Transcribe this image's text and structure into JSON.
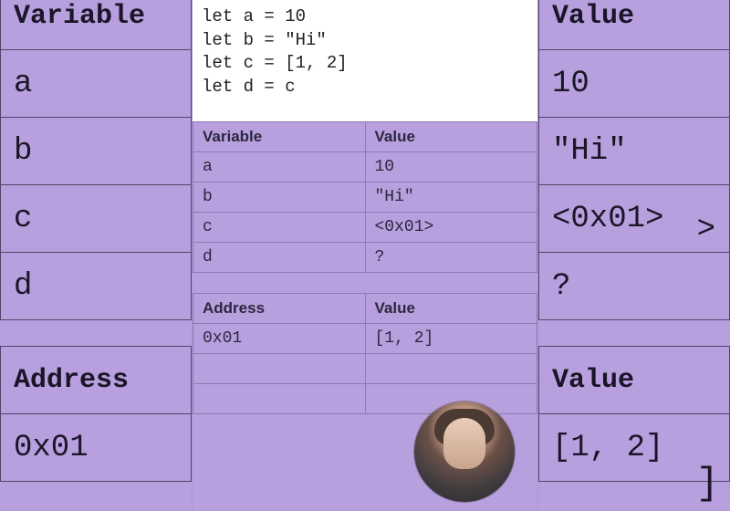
{
  "code": {
    "lines": [
      "let a = 10",
      "let b = \"Hi\"",
      "let c = [1, 2]",
      "let d = c"
    ]
  },
  "var_table": {
    "headers": {
      "col1": "Variable",
      "col2": "Value"
    },
    "rows": [
      {
        "name": "a",
        "value": "10"
      },
      {
        "name": "b",
        "value": "\"Hi\""
      },
      {
        "name": "c",
        "value": "<0x01>"
      },
      {
        "name": "d",
        "value": "?"
      }
    ]
  },
  "addr_table": {
    "headers": {
      "col1": "Address",
      "col2": "Value"
    },
    "rows": [
      {
        "addr": "0x01",
        "value": "[1, 2]"
      }
    ]
  },
  "bg_left": {
    "header": "Variable",
    "rows": [
      "a",
      "b",
      "c",
      "d"
    ],
    "header2": "Address",
    "rows2": [
      "0x01"
    ]
  },
  "bg_right": {
    "header": "Value",
    "rows": [
      "10",
      "\"Hi\"",
      "<0x01>",
      "?"
    ],
    "header2": "Value",
    "rows2": [
      "[1, 2]"
    ]
  },
  "stray": {
    "gt": ">",
    "bracket": "]"
  }
}
